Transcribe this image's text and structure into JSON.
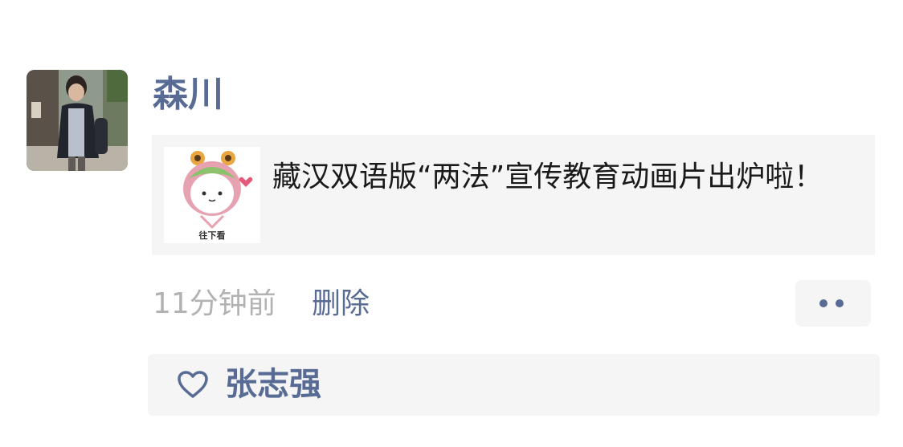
{
  "post": {
    "author": "森川",
    "link": {
      "title": "藏汉双语版“两法”宣传教育动画片出炉啦！",
      "thumb_caption": "往下看"
    },
    "time": "11分钟前",
    "delete_label": "删除",
    "more_icon": "more-dots-icon",
    "likes": {
      "icon": "heart-icon",
      "names": "张志强"
    }
  },
  "colors": {
    "link_blue": "#576b95",
    "time_gray": "#b2b2b2",
    "card_bg": "#f5f5f5"
  }
}
